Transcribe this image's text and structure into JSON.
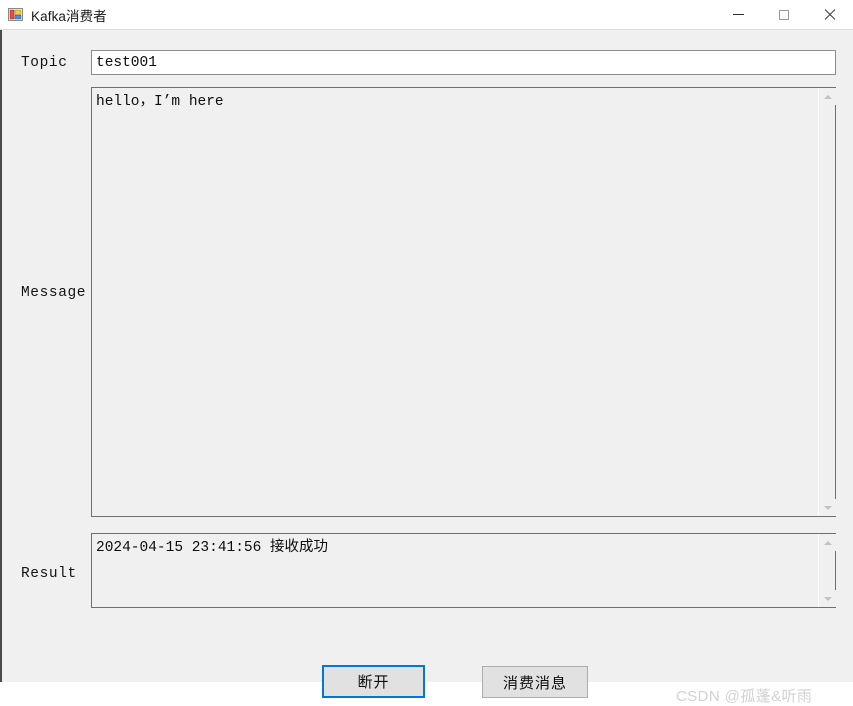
{
  "window": {
    "title": "Kafka消费者",
    "icon": "windows-forms-icon",
    "controls": {
      "minimize": "minimize-icon",
      "maximize": "maximize-icon",
      "close": "close-icon"
    }
  },
  "form": {
    "topic": {
      "label": "Topic",
      "value": "test001",
      "placeholder": ""
    },
    "message": {
      "label": "Message",
      "value": "hello，I’m here",
      "scrollbar": {
        "up": "chevron-up-icon",
        "down": "chevron-down-icon"
      }
    },
    "result": {
      "label": "Result",
      "value": "2024-04-15 23:41:56 接收成功",
      "scrollbar": {
        "up": "chevron-up-icon",
        "down": "chevron-down-icon"
      }
    }
  },
  "buttons": {
    "disconnect": "断开",
    "consume": "消费消息"
  },
  "watermark": "CSDN @孤蓬&听雨",
  "colors": {
    "form_background": "#f0f0f0",
    "titlebar_background": "#ffffff",
    "focus_border": "#0078d7",
    "button_face": "#e1e1e1",
    "button_border": "#adadad",
    "field_border": "#6f6f6f",
    "text": "#0d0d0d",
    "watermark": "#d2d2d2"
  }
}
